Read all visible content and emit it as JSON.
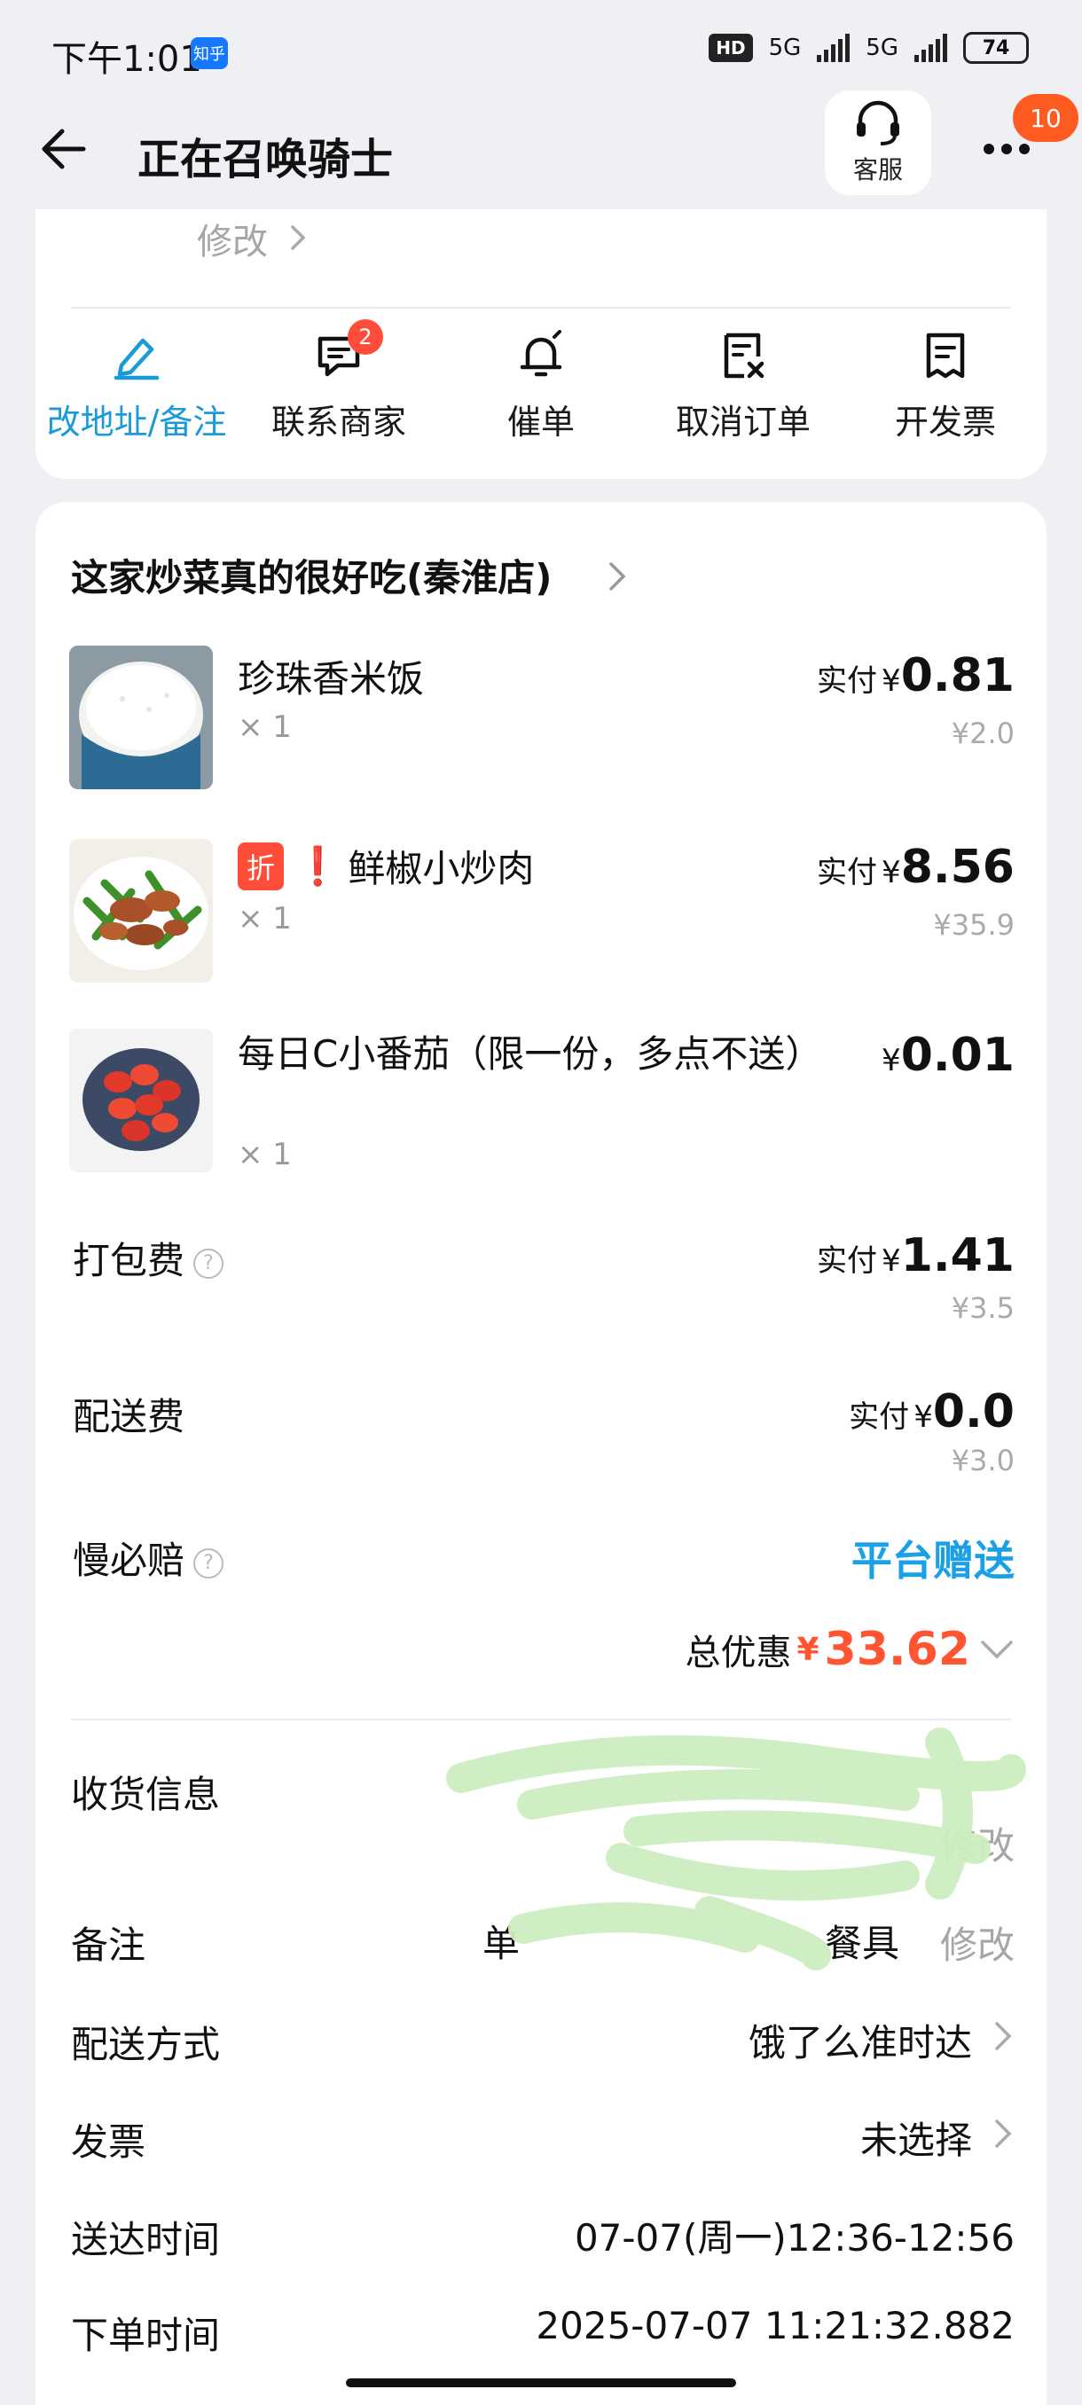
{
  "status_bar": {
    "time": "下午1:01",
    "app_badge": "知乎",
    "hd": "HD",
    "network_1": "5G",
    "network_2": "5G",
    "battery": "74"
  },
  "header": {
    "title": "正在召唤骑士",
    "service_label": "客服",
    "notification_count": "10"
  },
  "top_card": {
    "modify_label": "修改",
    "actions": [
      {
        "label": "改地址/备注",
        "icon": "edit-icon",
        "badge": ""
      },
      {
        "label": "联系商家",
        "icon": "chat-icon",
        "badge": "2"
      },
      {
        "label": "催单",
        "icon": "bell-icon",
        "badge": ""
      },
      {
        "label": "取消订单",
        "icon": "cancel-order-icon",
        "badge": ""
      },
      {
        "label": "开发票",
        "icon": "invoice-icon",
        "badge": ""
      }
    ]
  },
  "shop": {
    "name": "这家炒菜真的很好吃(秦淮店)"
  },
  "items": [
    {
      "name": "珍珠香米饭",
      "qty": "× 1",
      "paid_label": "实付",
      "currency": "¥",
      "paid": "0.81",
      "original": "¥2.0",
      "discount_tag": ""
    },
    {
      "name": "鲜椒小炒肉",
      "qty": "× 1",
      "paid_label": "实付",
      "currency": "¥",
      "paid": "8.56",
      "original": "¥35.9",
      "discount_tag": "折",
      "warning": "❗"
    },
    {
      "name": "每日C小番茄（限一份，多点不送）",
      "qty": "× 1",
      "paid_label": "",
      "currency": "¥",
      "paid": "0.01",
      "original": ""
    }
  ],
  "fees": {
    "packing": {
      "label": "打包费",
      "paid_label": "实付",
      "currency": "¥",
      "paid": "1.41",
      "original": "¥3.5"
    },
    "delivery": {
      "label": "配送费",
      "paid_label": "实付",
      "currency": "¥",
      "paid": "0.0",
      "original": "¥3.0"
    },
    "late_compensation": {
      "label": "慢必赔",
      "value": "平台赠送"
    }
  },
  "total": {
    "label": "总优惠",
    "currency": "¥",
    "amount": "33.62"
  },
  "order_info": {
    "receiver": {
      "label": "收货信息",
      "modify": "修改"
    },
    "note": {
      "label": "备注",
      "value_prefix": "单",
      "value_suffix": "餐具",
      "modify": "修改"
    },
    "delivery_method": {
      "label": "配送方式",
      "value": "饿了么准时达"
    },
    "invoice": {
      "label": "发票",
      "value": "未选择"
    },
    "arrival_time": {
      "label": "送达时间",
      "value": "07-07(周一)12:36-12:56"
    },
    "order_time": {
      "label": "下单时间",
      "value": "2025-07-07 11:21:32.882"
    }
  },
  "colors": {
    "accent_blue": "#1a9bd8",
    "platform_blue": "#1aa0e6",
    "discount_red": "#ff5533",
    "badge_orange": "#ff5a1f",
    "redaction_green": "#cdeec0"
  }
}
